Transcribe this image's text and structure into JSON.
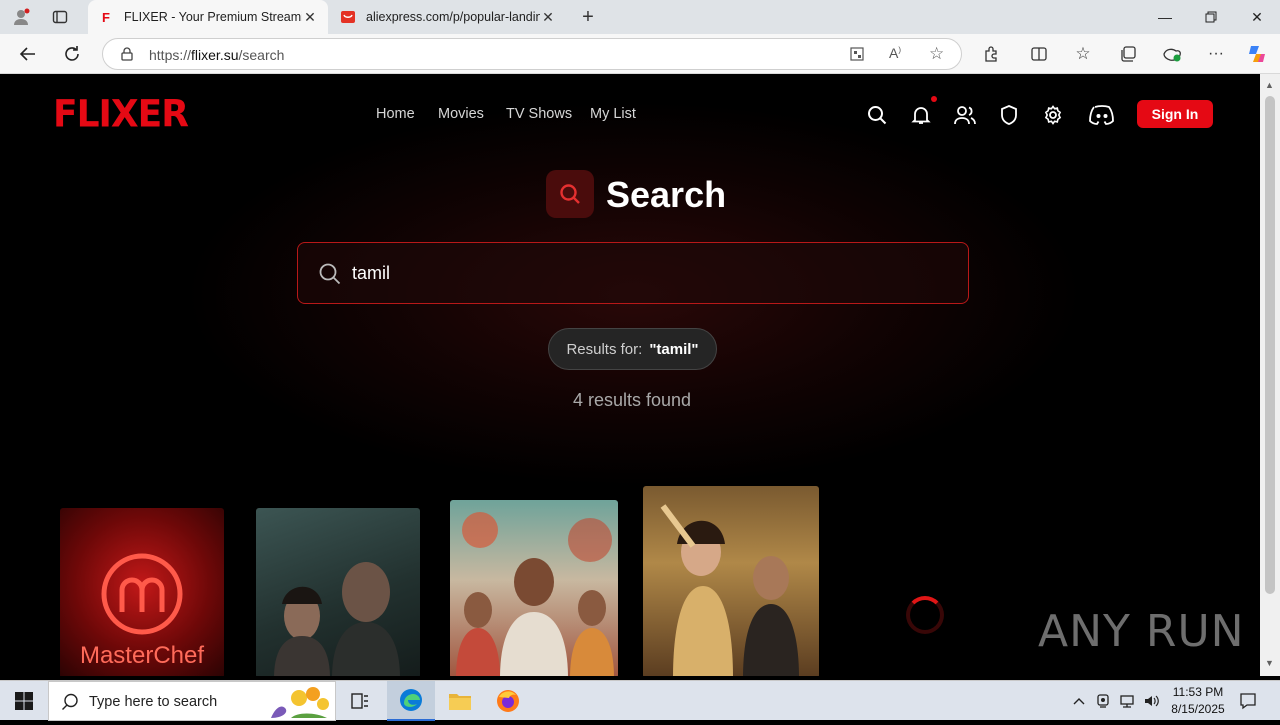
{
  "browser": {
    "tabs": [
      {
        "title": "FLIXER - Your Premium Streaming",
        "active": true,
        "favicon": "flixer-favicon"
      },
      {
        "title": "aliexpress.com/p/popular-landing",
        "active": false,
        "favicon": "aliexpress-favicon"
      }
    ],
    "address": {
      "scheme": "https://",
      "host": "flixer.su",
      "path": "/search"
    }
  },
  "site": {
    "logo": "FLIXER",
    "nav": [
      {
        "label": "Home"
      },
      {
        "label": "Movies"
      },
      {
        "label": "TV Shows"
      },
      {
        "label": "My List"
      }
    ],
    "header_icons": [
      "search-icon",
      "bell-icon",
      "users-icon",
      "shield-icon",
      "gear-icon",
      "discord-icon"
    ],
    "sign_in_label": "Sign In",
    "accent_color": "#e50914"
  },
  "search": {
    "title": "Search",
    "query": "tamil",
    "results_prefix": "Results for:",
    "results_query": "\"tamil\"",
    "results_count_text": "4 results found"
  },
  "results": [
    {
      "overlay_text": "MasterChef"
    },
    {
      "overlay_text": ""
    },
    {
      "overlay_text": ""
    },
    {
      "overlay_text": ""
    }
  ],
  "watermark": "ANY RUN",
  "taskbar": {
    "search_placeholder": "Type here to search",
    "time": "11:53 PM",
    "date": "8/15/2025"
  }
}
